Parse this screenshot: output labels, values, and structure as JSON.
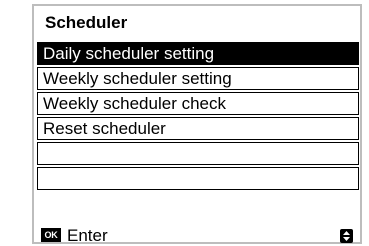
{
  "screen": {
    "title": "Scheduler",
    "menu_items": [
      {
        "label": "Daily scheduler  setting",
        "selected": true
      },
      {
        "label": "Weekly scheduler setting",
        "selected": false
      },
      {
        "label": "Weekly scheduler check",
        "selected": false
      },
      {
        "label": "Reset scheduler",
        "selected": false
      },
      {
        "label": "",
        "selected": false
      },
      {
        "label": "",
        "selected": false
      }
    ],
    "footer": {
      "ok_key": "OK",
      "ok_label": "Enter",
      "nav_icon": "up-down-arrows-icon"
    }
  }
}
